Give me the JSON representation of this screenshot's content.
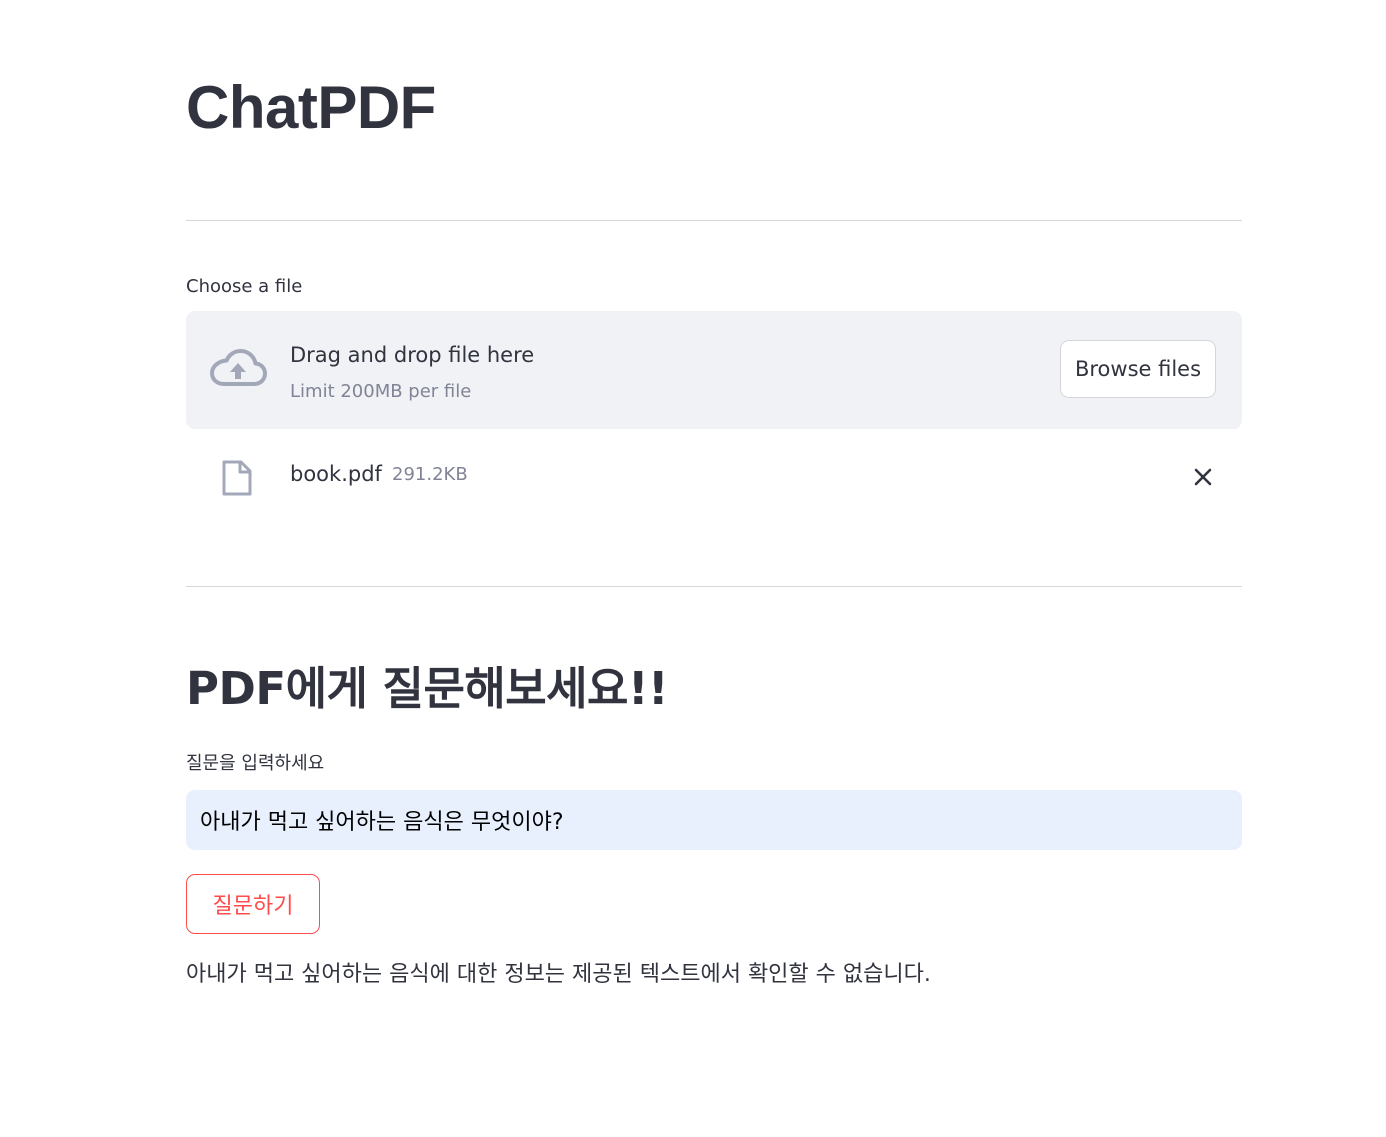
{
  "app": {
    "title": "ChatPDF"
  },
  "uploader": {
    "label": "Choose a file",
    "drop_text": "Drag and drop file here",
    "limit_text": "Limit 200MB per file",
    "browse_label": "Browse files",
    "file": {
      "name": "book.pdf",
      "size": "291.2KB"
    },
    "icons": {
      "upload": "cloud-upload-icon",
      "file": "file-icon",
      "remove": "close-icon"
    }
  },
  "question": {
    "heading": "PDF에게 질문해보세요!!",
    "input_label": "질문을 입력하세요",
    "input_value": "아내가 먹고 싶어하는 음식은 무엇이야?",
    "submit_label": "질문하기",
    "answer": "아내가 먹고 싶어하는 음식에 대한 정보는 제공된 텍스트에서 확인할 수 없습니다."
  },
  "colors": {
    "text": "#31333f",
    "muted": "#808495",
    "dropzone_bg": "#f0f2f6",
    "input_bg": "#e8f0fe",
    "accent": "#ff4b4b",
    "icon": "#a3a8b8"
  }
}
